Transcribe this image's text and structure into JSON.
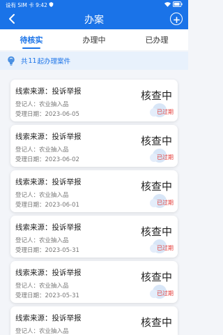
{
  "status_bar": {
    "carrier": "设有 SIM 卡",
    "time": "9:42",
    "battery": "B"
  },
  "nav": {
    "title": "办案"
  },
  "tabs": [
    {
      "label": "待核实",
      "active": true
    },
    {
      "label": "办理中",
      "active": false
    },
    {
      "label": "已办理",
      "active": false
    }
  ],
  "summary": {
    "prefix": "共",
    "count": "11",
    "suffix": "起办理案件"
  },
  "cases": [
    {
      "source": "线索来源：投诉举报",
      "registrant": "登记人：农业抽入品",
      "accept_date": "受理日期：2023-06-05",
      "status": "核查中",
      "expired": "已过期"
    },
    {
      "source": "线索来源：投诉举报",
      "registrant": "登记人：农业抽入品",
      "accept_date": "受理日期：2023-06-02",
      "status": "核查中",
      "expired": "已过期"
    },
    {
      "source": "线索来源：投诉举报",
      "registrant": "登记人：农业抽入品",
      "accept_date": "受理日期：2023-06-01",
      "status": "核查中",
      "expired": "已过期"
    },
    {
      "source": "线索来源：投诉举报",
      "registrant": "登记人：农业抽入品",
      "accept_date": "受理日期：2023-05-31",
      "status": "核查中",
      "expired": "已过期"
    },
    {
      "source": "线索来源：投诉举报",
      "registrant": "登记人：农业抽入品",
      "accept_date": "受理日期：2023-05-31",
      "status": "核查中",
      "expired": "已过期"
    },
    {
      "source": "线索来源：投诉举报",
      "registrant": "登记人：农业抽入品",
      "accept_date": "",
      "status": "核查中",
      "expired": ""
    }
  ],
  "colors": {
    "primary": "#1a73e8",
    "expired": "#e53935",
    "summary_bg": "#e8f1fc"
  },
  "icons": {
    "back": "chevron-left-icon",
    "add": "plus-circle-icon",
    "summary": "lightbulb-icon"
  }
}
